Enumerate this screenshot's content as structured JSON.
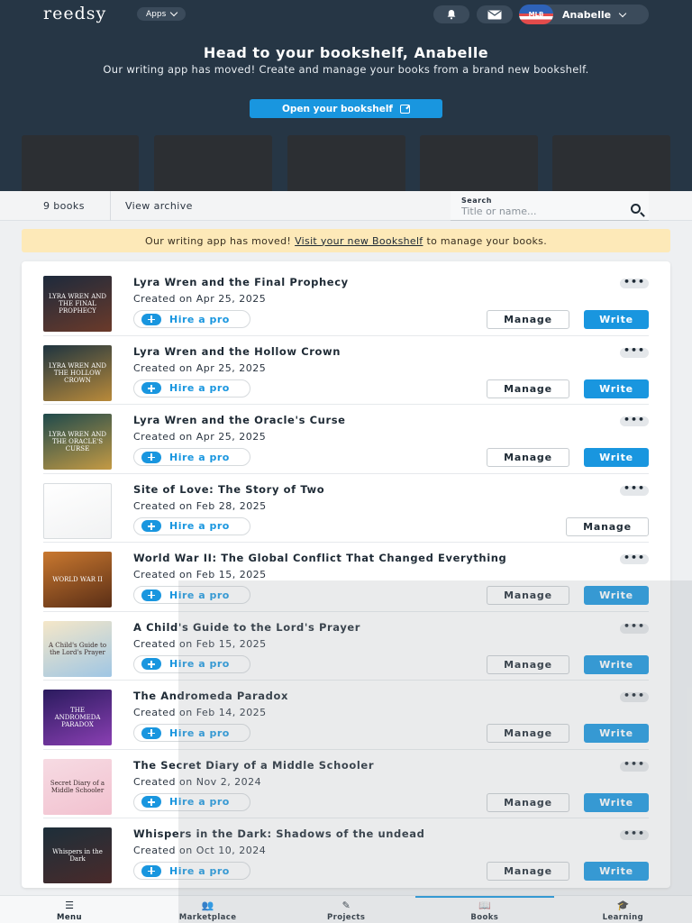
{
  "header": {
    "logo": "reedsy",
    "apps_label": "Apps",
    "user_name": "Anabelle",
    "avatar_text": "MLB",
    "hero_title": "Head to your bookshelf, Anabelle",
    "hero_subtitle": "Our writing app has moved! Create and manage your books from a brand new bookshelf.",
    "open_bookshelf_label": "Open your bookshelf"
  },
  "filters": {
    "book_count": "9 books",
    "view_archive": "View archive",
    "search_label": "Search",
    "search_placeholder": "Title or name..."
  },
  "notice": {
    "prefix": "Our writing app has moved!",
    "link": "Visit your new Bookshelf",
    "suffix": "to manage your books."
  },
  "labels": {
    "hire_a_pro": "Hire a pro",
    "manage": "Manage",
    "write": "Write",
    "more": "•••"
  },
  "books": [
    {
      "title": "Lyra Wren and the Final Prophecy",
      "date": "Created on Apr 25, 2025",
      "cover_text": "LYRA WREN AND THE FINAL PROPHECY",
      "cover_colors": [
        "#1d2a3c",
        "#6b3a2a"
      ],
      "has_write": true
    },
    {
      "title": "Lyra Wren and the Hollow Crown",
      "date": "Created on Apr 25, 2025",
      "cover_text": "LYRA WREN AND THE HOLLOW CROWN",
      "cover_colors": [
        "#1e3440",
        "#b98a3a"
      ],
      "has_write": true
    },
    {
      "title": "Lyra Wren and the Oracle's Curse",
      "date": "Created on Apr 25, 2025",
      "cover_text": "LYRA WREN AND THE ORACLE'S CURSE",
      "cover_colors": [
        "#1f4a4c",
        "#c49a44"
      ],
      "has_write": true
    },
    {
      "title": "Site of Love: The Story of Two",
      "date": "Created on Feb 28, 2025",
      "cover_text": "",
      "cover_colors": [
        "#ffffff",
        "#f1f2f3"
      ],
      "has_write": false
    },
    {
      "title": "World War II: The Global Conflict That Changed Everything",
      "date": "Created on Feb 15, 2025",
      "cover_text": "WORLD WAR II",
      "cover_colors": [
        "#c9782f",
        "#5a2e16"
      ],
      "has_write": true
    },
    {
      "title": "A Child's Guide to the Lord's Prayer",
      "date": "Created on Feb 15, 2025",
      "cover_text": "A Child's Guide to the Lord's Prayer",
      "cover_colors": [
        "#f5e7c8",
        "#9fc6e4"
      ],
      "has_write": true
    },
    {
      "title": "The Andromeda Paradox",
      "date": "Created on Feb 14, 2025",
      "cover_text": "THE ANDROMEDA PARADOX",
      "cover_colors": [
        "#2a1b5e",
        "#8a3fb3"
      ],
      "has_write": true
    },
    {
      "title": "The Secret Diary of a Middle Schooler",
      "date": "Created on Nov 2, 2024",
      "cover_text": "Secret Diary of a Middle Schooler",
      "cover_colors": [
        "#f6dbe3",
        "#f2c1cf"
      ],
      "has_write": true
    },
    {
      "title": "Whispers in the Dark: Shadows of the undead",
      "date": "Created on Oct 10, 2024",
      "cover_text": "Whispers in the Dark",
      "cover_colors": [
        "#1d2f3a",
        "#4a2a2a"
      ],
      "has_write": true
    }
  ],
  "bottom_nav": [
    {
      "label": "Menu",
      "icon": "menu-icon",
      "glyph": "☰",
      "active": false
    },
    {
      "label": "Marketplace",
      "icon": "people-icon",
      "glyph": "👥",
      "active": false
    },
    {
      "label": "Projects",
      "icon": "pen-icon",
      "glyph": "✎",
      "active": false
    },
    {
      "label": "Books",
      "icon": "book-icon",
      "glyph": "📖",
      "active": true
    },
    {
      "label": "Learning",
      "icon": "graduation-cap-icon",
      "glyph": "🎓",
      "active": false
    }
  ]
}
